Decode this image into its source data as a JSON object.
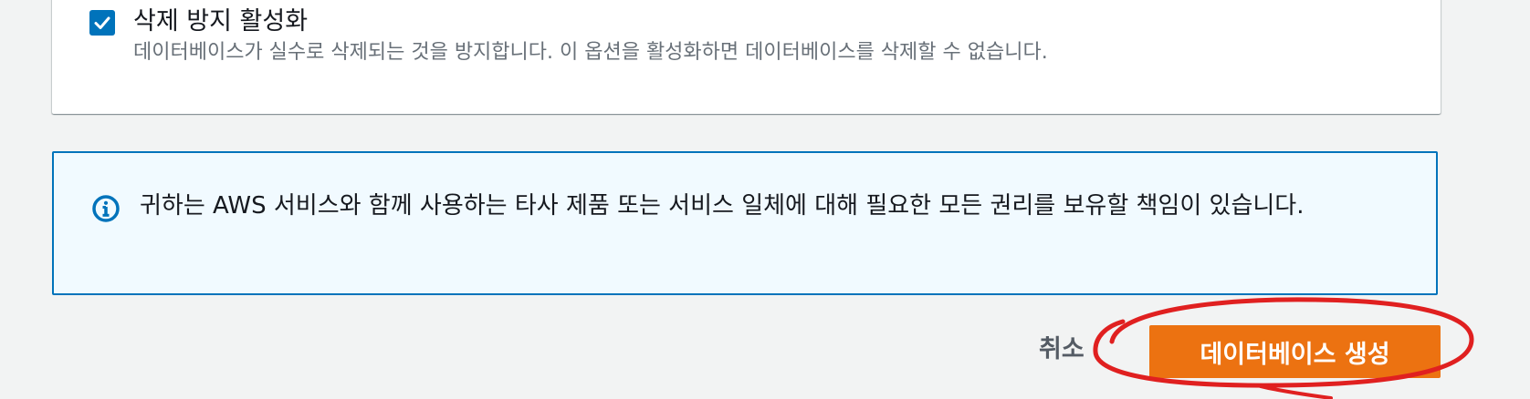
{
  "deletion_protection": {
    "checked": true,
    "label": "삭제 방지 활성화",
    "description": "데이터베이스가 실수로 삭제되는 것을 방지합니다. 이 옵션을 활성화하면 데이터베이스를 삭제할 수 없습니다."
  },
  "info_alert": {
    "icon": "info-circle-icon",
    "text": "귀하는 AWS 서비스와 함께 사용하는 타사 제품 또는 서비스 일체에 대해 필요한 모든 권리를 보유할 책임이 있습니다."
  },
  "actions": {
    "cancel_label": "취소",
    "create_label": "데이터베이스 생성"
  },
  "colors": {
    "page_background": "#f2f3f3",
    "checkbox": "#0073bb",
    "alert_border": "#0073bb",
    "alert_background": "#f1faff",
    "primary_button": "#ec7211",
    "annotation": "#e02020"
  }
}
